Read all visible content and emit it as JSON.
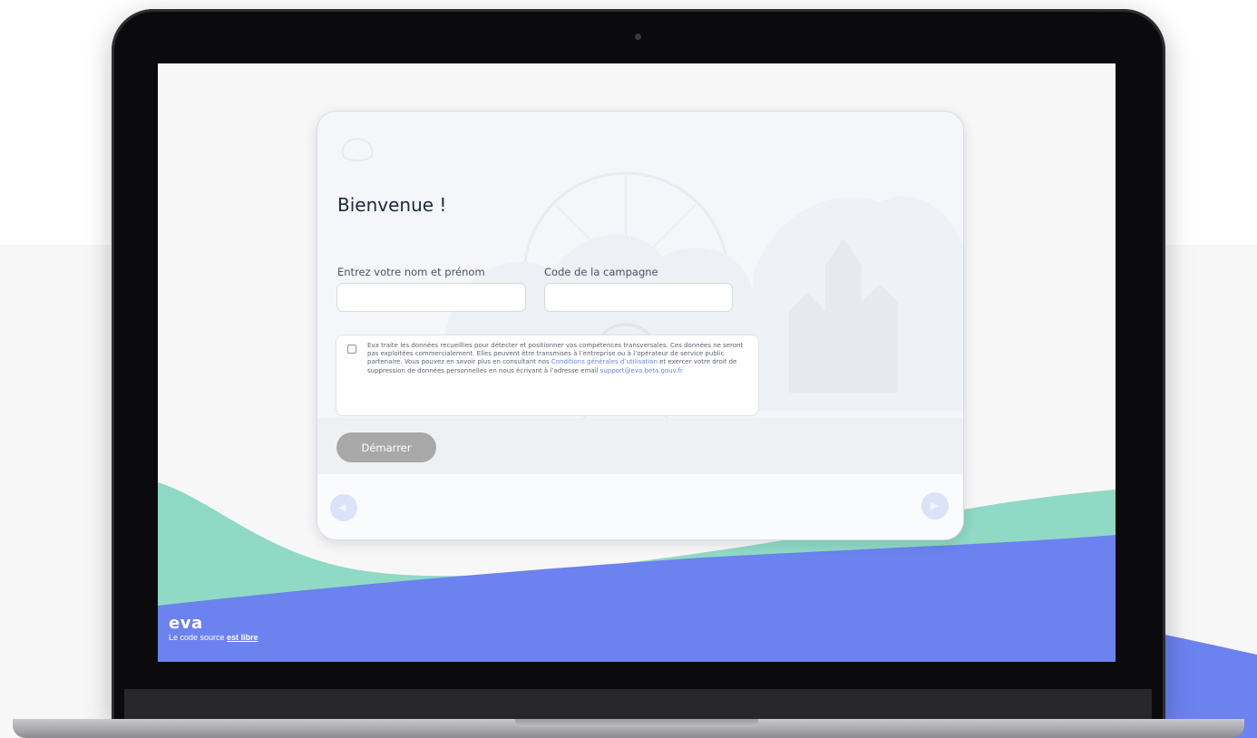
{
  "page": {
    "title": "Bienvenue !",
    "faded_header_label": "",
    "fields": [
      {
        "label": "Entrez votre nom et prénom",
        "value": "",
        "placeholder": ""
      },
      {
        "label": "Code de la campagne",
        "value": "",
        "placeholder": ""
      }
    ],
    "consent": {
      "checked": false,
      "text_before_link_1": "Eva traite les données recueillies pour détecter et positionner vos compétences transversales. Ces données ne seront pas exploitées commercialement. Elles peuvent être transmises à l’entreprise ou à l’opérateur de service public partenaire. Vous pouvez en savoir plus en consultant nos ",
      "link_1": "Conditions générales d’utilisation",
      "text_between_links": " et exercer votre droit de suppression de données personnelles en nous écrivant à l’adresse email ",
      "link_2": "support@eva.beta.gouv.fr"
    },
    "start_button": "Démarrer",
    "footer_nav": {
      "left": "",
      "right": ""
    }
  },
  "footer": {
    "brand": "eva",
    "text_prefix": "Le code source ",
    "link": "est libre"
  },
  "colors": {
    "accent_blue": "#6c82ef",
    "teal": "#8fd9c5",
    "button_disabled": "#a8a8a8",
    "title": "#1d2a3a"
  },
  "icons": {
    "checkbox": "checkbox-icon",
    "arrow_left": "arrow-left-icon",
    "arrow_right": "arrow-right-icon",
    "ferris_wheel": "ferris-wheel-illustration"
  }
}
